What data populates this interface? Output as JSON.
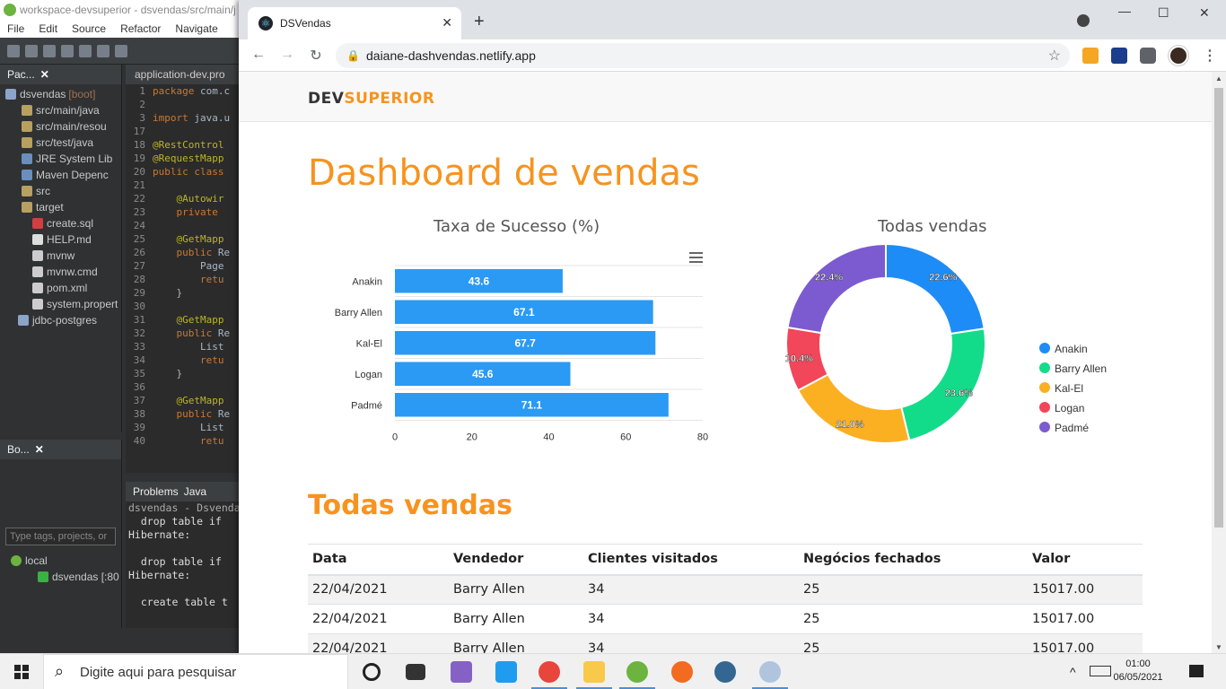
{
  "eclipse": {
    "title": "workspace-devsuperior - dsvendas/src/main/j",
    "menu": [
      "File",
      "Edit",
      "Source",
      "Refactor",
      "Navigate"
    ],
    "package_tab": "Pac...",
    "project_name": "dsvendas",
    "project_tag": "[boot]",
    "tree": [
      "src/main/java",
      "src/main/resou",
      "src/test/java",
      "JRE System Lib",
      "Maven Depenc",
      "src",
      "target",
      "create.sql",
      "HELP.md",
      "mvnw",
      "mvnw.cmd",
      "pom.xml",
      "system.propert",
      "jdbc-postgres"
    ],
    "editor_tab": "application-dev.pro",
    "code_lines": [
      {
        "n": "1",
        "kw": "package",
        "tx": " com.c"
      },
      {
        "n": "2",
        "kw": "",
        "tx": ""
      },
      {
        "n": "3",
        "kw": "import",
        "tx": " java.u"
      },
      {
        "n": "17",
        "kw": "",
        "tx": ""
      },
      {
        "n": "18",
        "an": "@RestControl",
        "tx": ""
      },
      {
        "n": "19",
        "an": "@RequestMapp",
        "tx": ""
      },
      {
        "n": "20",
        "kw": "public class",
        "tx": ""
      },
      {
        "n": "21",
        "kw": "",
        "tx": ""
      },
      {
        "n": "22",
        "an": "    @Autowir",
        "tx": ""
      },
      {
        "n": "23",
        "kw": "    private",
        "tx": ""
      },
      {
        "n": "24",
        "kw": "",
        "tx": ""
      },
      {
        "n": "25",
        "an": "    @GetMapp",
        "tx": ""
      },
      {
        "n": "26",
        "kw": "    public",
        "tx": " Re"
      },
      {
        "n": "27",
        "kw": "",
        "tx": "        Page"
      },
      {
        "n": "28",
        "kw": "        retu",
        "tx": ""
      },
      {
        "n": "29",
        "kw": "",
        "tx": "    }"
      },
      {
        "n": "30",
        "kw": "",
        "tx": ""
      },
      {
        "n": "31",
        "an": "    @GetMapp",
        "tx": ""
      },
      {
        "n": "32",
        "kw": "    public",
        "tx": " Re"
      },
      {
        "n": "33",
        "kw": "",
        "tx": "        List"
      },
      {
        "n": "34",
        "kw": "        retu",
        "tx": ""
      },
      {
        "n": "35",
        "kw": "",
        "tx": "    }"
      },
      {
        "n": "36",
        "kw": "",
        "tx": ""
      },
      {
        "n": "37",
        "an": "    @GetMapp",
        "tx": ""
      },
      {
        "n": "38",
        "kw": "    public",
        "tx": " Re"
      },
      {
        "n": "39",
        "kw": "",
        "tx": "        List"
      },
      {
        "n": "40",
        "kw": "        retu",
        "tx": ""
      }
    ],
    "boot_tab": "Bo...",
    "filter_placeholder": "Type tags, projects, or",
    "local": "local",
    "local_app": "dsvendas [:80",
    "console_tabs": [
      "Problems",
      "Java"
    ],
    "console_header": "dsvendas - DsvendasAp",
    "console_lines": [
      "  drop table if",
      "Hibernate:",
      "",
      "  drop table if",
      "Hibernate:",
      "",
      "  create table t"
    ]
  },
  "browser": {
    "tab_title": "DSVendas",
    "url": "daiane-dashvendas.netlify.app"
  },
  "page": {
    "brand_dev": "DEV",
    "brand_superior": "SUPERIOR",
    "title": "Dashboard de vendas",
    "bar_chart_title": "Taxa de Sucesso (%)",
    "donut_chart_title": "Todas vendas",
    "table_title": "Todas vendas",
    "table": {
      "headers": [
        "Data",
        "Vendedor",
        "Clientes visitados",
        "Negócios fechados",
        "Valor"
      ],
      "rows": [
        [
          "22/04/2021",
          "Barry Allen",
          "34",
          "25",
          "15017.00"
        ],
        [
          "22/04/2021",
          "Barry Allen",
          "34",
          "25",
          "15017.00"
        ],
        [
          "22/04/2021",
          "Barry Allen",
          "34",
          "25",
          "15017.00"
        ]
      ]
    }
  },
  "chart_data": [
    {
      "type": "bar",
      "orientation": "horizontal",
      "title": "Taxa de Sucesso (%)",
      "categories": [
        "Anakin",
        "Barry Allen",
        "Kal-El",
        "Logan",
        "Padmé"
      ],
      "values": [
        43.6,
        67.1,
        67.7,
        45.6,
        71.1
      ],
      "xlim": [
        0,
        80
      ],
      "xticks": [
        0,
        20,
        40,
        60,
        80
      ],
      "color": "#2a9af4"
    },
    {
      "type": "pie",
      "donut": true,
      "title": "Todas vendas",
      "labels": [
        "Anakin",
        "Barry Allen",
        "Kal-El",
        "Logan",
        "Padmé"
      ],
      "values": [
        22.6,
        23.6,
        21.0,
        10.4,
        22.4
      ],
      "data_labels": [
        "22.6%",
        "23.6%",
        "21.0%",
        "10.4%",
        "22.4%"
      ],
      "colors": [
        "#1e8cf6",
        "#12dc8a",
        "#fbb022",
        "#f2465a",
        "#7c5bd1"
      ],
      "legend": "right"
    }
  ],
  "taskbar": {
    "search_placeholder": "Digite aqui para pesquisar",
    "time": "01:00",
    "date": "06/05/2021"
  }
}
